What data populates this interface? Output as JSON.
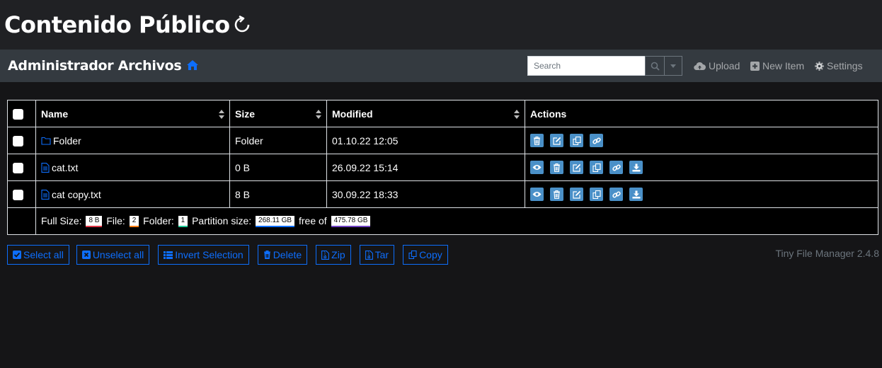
{
  "page_title": "Contenido Público",
  "navbar": {
    "brand": "Administrador Archivos",
    "search_placeholder": "Search",
    "links": {
      "upload": "Upload",
      "new_item": "New Item",
      "settings": "Settings"
    }
  },
  "table": {
    "headers": {
      "name": "Name",
      "size": "Size",
      "modified": "Modified",
      "actions": "Actions"
    },
    "rows": [
      {
        "name": "Folder",
        "size": "Folder",
        "modified": "01.10.22 12:05",
        "type": "folder"
      },
      {
        "name": "cat.txt",
        "size": "0 B",
        "modified": "26.09.22 15:14",
        "type": "file"
      },
      {
        "name": "cat copy.txt",
        "size": "8 B",
        "modified": "30.09.22 18:33",
        "type": "file"
      }
    ],
    "footer": {
      "full_size_label": "Full Size:",
      "full_size": "8 B",
      "file_label": "File:",
      "file_count": "2",
      "folder_label": "Folder:",
      "folder_count": "1",
      "partition_label": "Partition size:",
      "partition_size": "268.11 GB",
      "free_of_label": "free of",
      "total_size": "475.78 GB"
    }
  },
  "bulk_actions": {
    "select_all": "Select all",
    "unselect_all": "Unselect all",
    "invert": "Invert Selection",
    "delete": "Delete",
    "zip": "Zip",
    "tar": "Tar",
    "copy": "Copy"
  },
  "version": "Tiny File Manager 2.4.8",
  "colors": {
    "link_blue": "#0d6efd",
    "action_blue": "#4a90c8",
    "navbar_bg": "#343a40",
    "page_bg": "#151517"
  }
}
